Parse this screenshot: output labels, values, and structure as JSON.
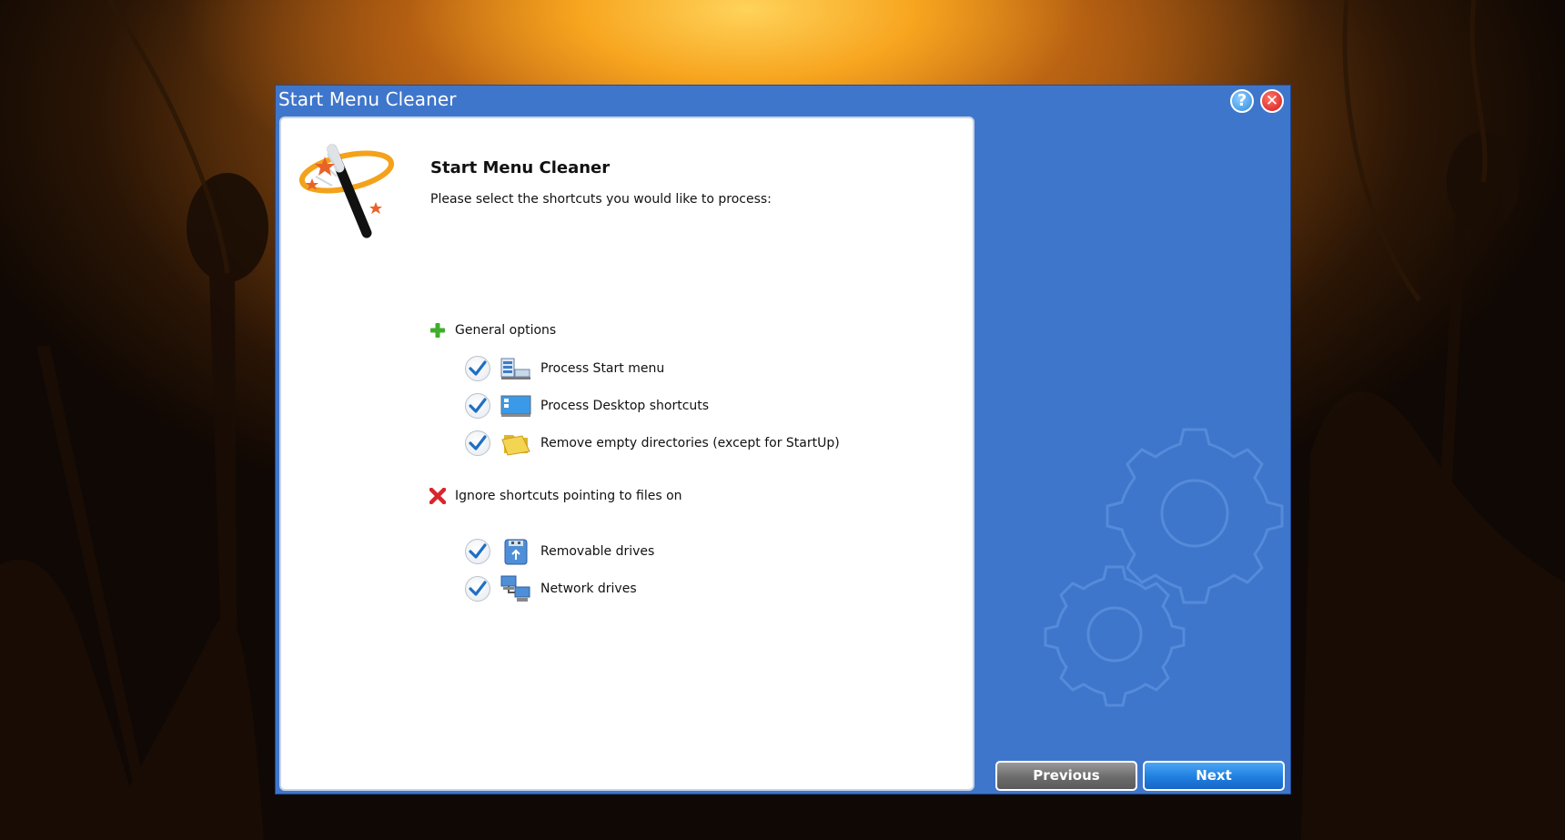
{
  "window": {
    "title": "Start Menu Cleaner",
    "help_label": "?",
    "close_label": "✕"
  },
  "content": {
    "heading": "Start Menu Cleaner",
    "subtitle": "Please select the shortcuts you would like to process:"
  },
  "sections": {
    "general": {
      "label": "General options",
      "icon": "green-plus-icon",
      "options": [
        {
          "label": "Process Start menu",
          "checked": true,
          "icon": "start-menu-icon"
        },
        {
          "label": "Process Desktop shortcuts",
          "checked": true,
          "icon": "desktop-icon"
        },
        {
          "label": "Remove empty directories (except for StartUp)",
          "checked": true,
          "icon": "folder-icon"
        }
      ]
    },
    "ignore": {
      "label": "Ignore shortcuts pointing to files on",
      "icon": "red-x-icon",
      "options": [
        {
          "label": "Removable drives",
          "checked": true,
          "icon": "usb-drive-icon"
        },
        {
          "label": "Network drives",
          "checked": true,
          "icon": "network-drives-icon"
        }
      ]
    }
  },
  "buttons": {
    "previous": "Previous",
    "next": "Next"
  },
  "colors": {
    "window_blue": "#3e76cc",
    "check_blue": "#1f6fc4",
    "next_blue": "#1f7fe0",
    "previous_gray": "#6c6c6c"
  }
}
